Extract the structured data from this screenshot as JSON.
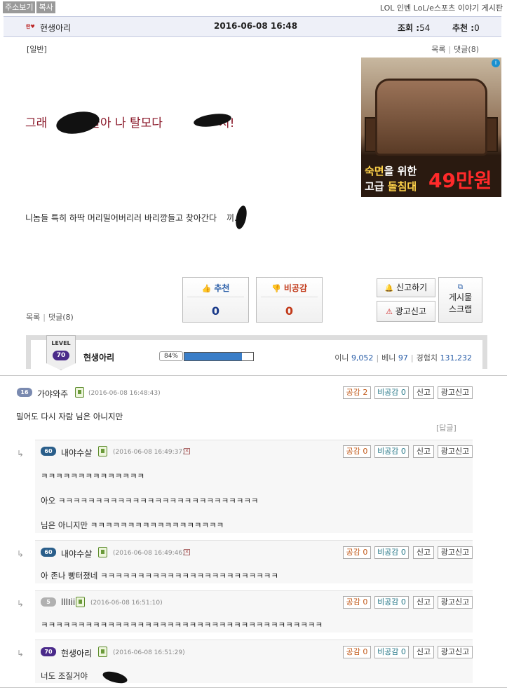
{
  "topbar": {
    "btn1": "주소보기",
    "btn2": "복사",
    "board": "LOL 인벤 LoL/e스포츠 이야기 게시판"
  },
  "header": {
    "author": "현생아리",
    "date": "2016-06-08 16:48",
    "views_label": "조회 :",
    "views": "54",
    "recs_label": "추천 :",
    "recs": "0"
  },
  "post": {
    "category": "[일반]",
    "list_link": "목록",
    "comments_link": "댓글(8)",
    "headline_a": "그래",
    "headline_b": "들아 나 탈모다",
    "headline_c": "치!",
    "body_a": "니놈들 특히 하딱 머리밀어버리러 바리깡들고 찾아간다",
    "body_b": "끼...."
  },
  "ad": {
    "line1_a": "숙면",
    "line1_b": "을 위한",
    "line2_a": "고급 ",
    "line2_b": "돌침대",
    "price": "49만원",
    "info": "i"
  },
  "votes": {
    "rec_label": "추천",
    "rec_count": "0",
    "dis_label": "비공감",
    "dis_count": "0",
    "report": "신고하기",
    "ad_report": "광고신고",
    "scrap_line1": "게시물",
    "scrap_line2": "스크랩",
    "list_link": "목록",
    "comments_link": "댓글(8)"
  },
  "profile": {
    "level_label": "LEVEL",
    "level": "70",
    "name": "현생아리",
    "exp_pct_label": "84%",
    "exp_pct": 0.84,
    "ini_label": "이니",
    "ini": "9,052",
    "beni_label": "베니",
    "beni": "97",
    "exp_label": "경험치",
    "exp": "131,232"
  },
  "comments": [
    {
      "level": "16",
      "lv_color": "#7a8ab0",
      "name": "가야와주",
      "time": "(2016-06-08 16:48:43)",
      "up": "공감 2",
      "down": "비공감 0",
      "report": "신고",
      "ad_report": "광고신고",
      "lines": [
        "밀어도 다시 자람 님은 아니지만"
      ],
      "reply_link": "[답글]"
    },
    {
      "level": "60",
      "lv_color": "#2a5e8a",
      "name": "내야수살",
      "time": "(2016-06-08 16:49:37)",
      "up": "공감 0",
      "down": "비공감 0",
      "report": "신고",
      "ad_report": "광고신고",
      "lines": [
        "ㅋㅋㅋㅋㅋㅋㅋㅋㅋㅋㅋㅋㅋㅋ",
        "아오 ㅋㅋㅋㅋㅋㅋㅋㅋㅋㅋㅋㅋㅋㅋㅋㅋㅋㅋㅋㅋㅋㅋㅋㅋㅋㅋㅋ",
        "님은 아니지만 ㅋㅋㅋㅋㅋㅋㅋㅋㅋㅋㅋㅋㅋㅋㅋㅋㅋㅋ"
      ]
    },
    {
      "level": "60",
      "lv_color": "#2a5e8a",
      "name": "내야수살",
      "time": "(2016-06-08 16:49:46)",
      "up": "공감 0",
      "down": "비공감 0",
      "report": "신고",
      "ad_report": "광고신고",
      "lines": [
        "아 존나 빵터졌네 ㅋㅋㅋㅋㅋㅋㅋㅋㅋㅋㅋㅋㅋㅋㅋㅋㅋㅋㅋㅋㅋㅋㅋㅋ"
      ]
    },
    {
      "level": "5",
      "lv_color": "#b0b0b0",
      "name": "lllIii",
      "time": "(2016-06-08 16:51:10)",
      "up": "공감 0",
      "down": "비공감 0",
      "report": "신고",
      "ad_report": "광고신고",
      "lines": [
        "ㅋㅋㅋㅋㅋㅋㅋㅋㅋㅋㅋㅋㅋㅋㅋㅋㅋㅋㅋㅋㅋㅋㅋㅋㅋㅋㅋㅋㅋㅋㅋㅋㅋㅋㅋㅋㅋㅋ"
      ]
    },
    {
      "level": "70",
      "lv_color": "#4a2a8a",
      "name": "현생아리",
      "time": "(2016-06-08 16:51:29)",
      "up": "공감 0",
      "down": "비공감 0",
      "report": "신고",
      "ad_report": "광고신고",
      "lines": [
        "너도 조질거야"
      ]
    }
  ],
  "icons": {
    "arrow": "↳",
    "x_mark": "✕",
    "thumb_up": "👍",
    "thumb_down": "👎",
    "bell": "🔔",
    "warn": "⚠"
  }
}
